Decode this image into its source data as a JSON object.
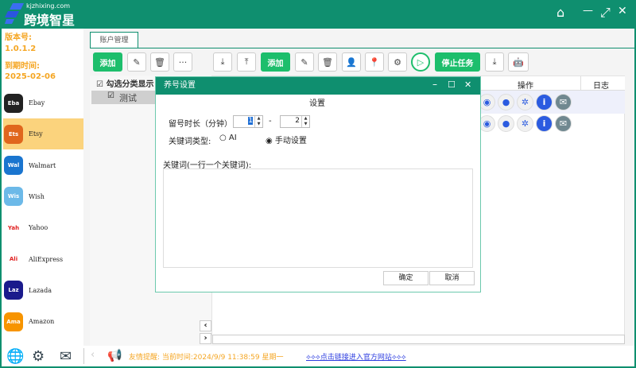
{
  "header": {
    "site": "kjzhixing.com",
    "brand": "跨境智星",
    "window": {
      "home": "⌂",
      "min": "—",
      "restore": "⤢",
      "close": "✕"
    }
  },
  "sidebar": {
    "version_label": "版本号:",
    "version": "1.0.1.2",
    "expire_label": "到期时间:",
    "expire": "2025-02-06",
    "platforms": [
      {
        "label": "Ebay",
        "icon": "ebay-icon",
        "color": "#222222"
      },
      {
        "label": "Etsy",
        "icon": "etsy-icon",
        "color": "#e0661d",
        "selected": true
      },
      {
        "label": "Walmart",
        "icon": "walmart-icon",
        "color": "#1a75cf"
      },
      {
        "label": "Wish",
        "icon": "wish-icon",
        "color": "#6cb9e8"
      },
      {
        "label": "Yahoo",
        "icon": "yahoo-icon",
        "color": "#ffffff"
      },
      {
        "label": "AliExpress",
        "icon": "aliexpress-icon",
        "color": "#ffffff"
      },
      {
        "label": "Lazada",
        "icon": "lazada-icon",
        "color": "#1a1a8c"
      },
      {
        "label": "Amazon",
        "icon": "amazon-icon",
        "color": "#f79400"
      }
    ]
  },
  "tab": {
    "label": "账户管理"
  },
  "left_toolbar": {
    "add": "添加"
  },
  "left_list": {
    "show_category": "勾选分类显示",
    "items": [
      "测试"
    ]
  },
  "toolbar": {
    "add": "添加",
    "stop": "停止任务"
  },
  "grid": {
    "columns": [
      "操作",
      "日志"
    ],
    "rows": 2
  },
  "dialog": {
    "title": "养号设置",
    "heading": "设置",
    "duration_label": "留号时长（分钟）",
    "min_value": "1",
    "dash": "-",
    "max_value": "2",
    "keyword_type_label": "关键词类型:",
    "options": [
      "AI",
      "手动设置"
    ],
    "selected_option": "手动设置",
    "keywords_label": "关键词(一行一个关键词):",
    "keywords_value": "",
    "ok": "确定",
    "cancel": "取消"
  },
  "footer": {
    "tip": "友情提醒:  当前时间:2024/9/9  11:38:59 星期一",
    "link": "⟡⟡⟡点击链接进入官方网站⟡⟡⟡"
  },
  "colors": {
    "brand": "#0f8f6f",
    "accent": "#1dbe6c",
    "info": "#f5a623",
    "selected": "#fbd37d"
  }
}
